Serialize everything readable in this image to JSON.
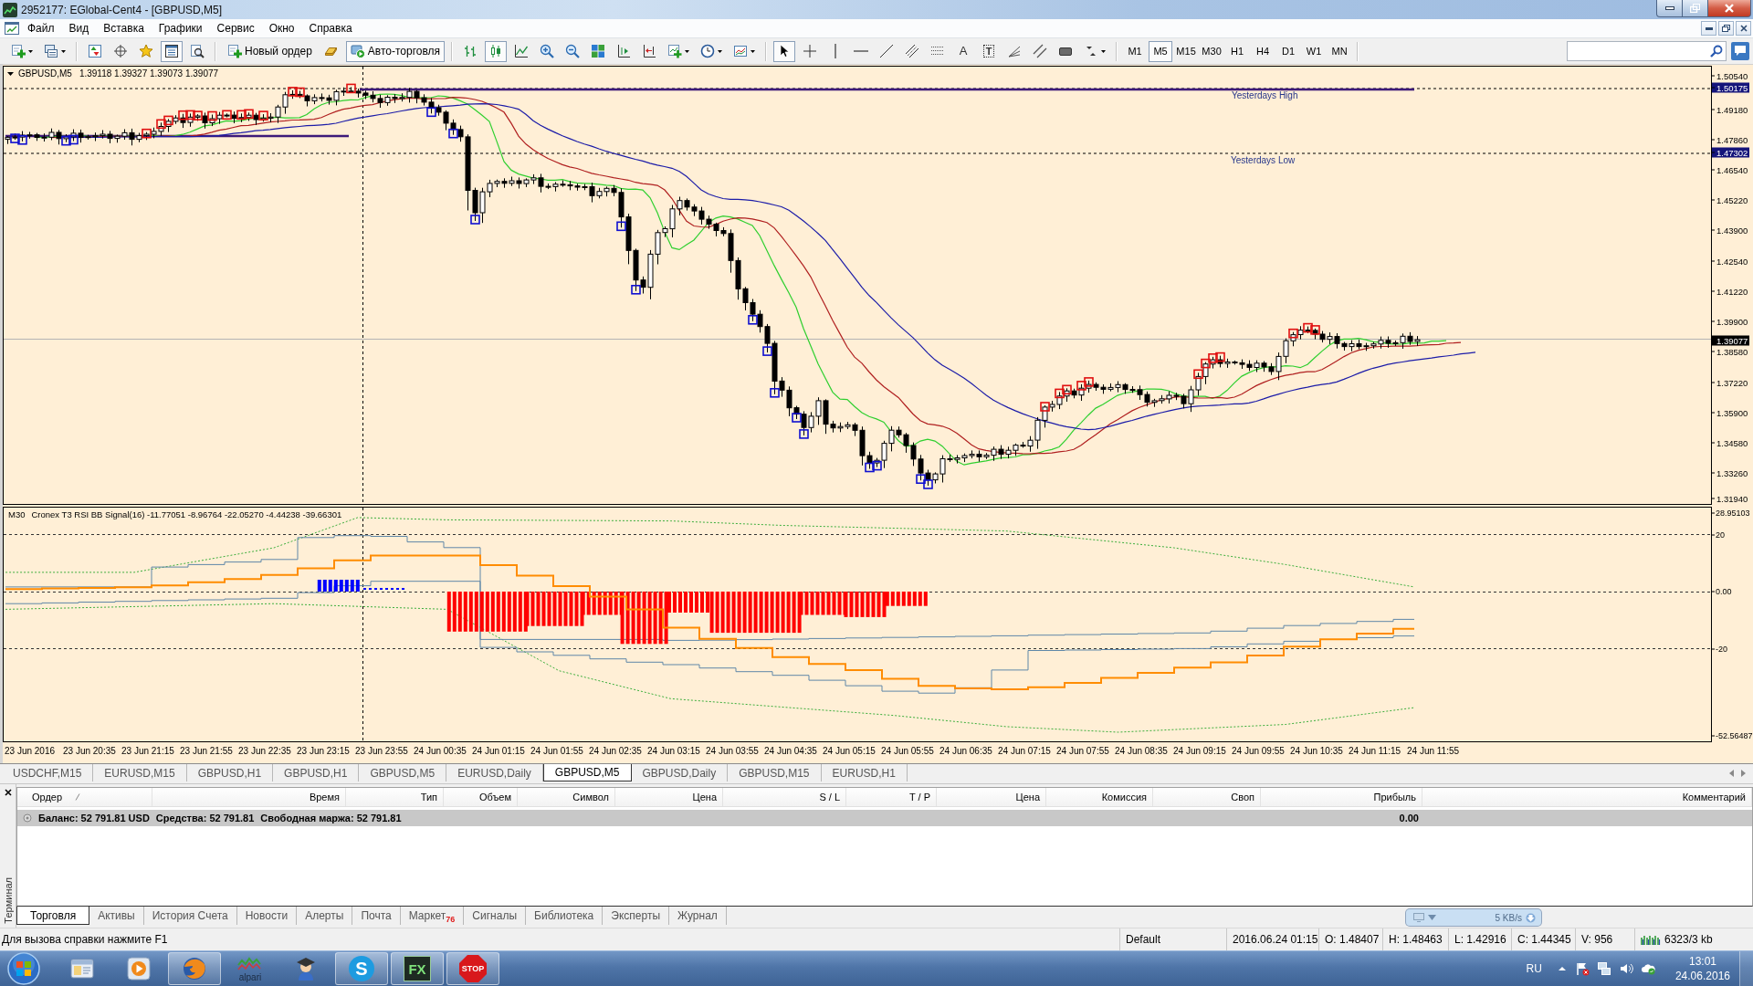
{
  "window": {
    "title": "2952177: EGlobal-Cent4 - [GBPUSD,M5]"
  },
  "menu": [
    "Файл",
    "Вид",
    "Вставка",
    "Графики",
    "Сервис",
    "Окно",
    "Справка"
  ],
  "toolbar": {
    "view_buttons": [
      {
        "pressed": false
      },
      {
        "pressed": false
      },
      {
        "pressed": false
      },
      {
        "pressed": true
      },
      {
        "pressed": false
      }
    ],
    "new_order": {
      "label": "Новый ордер"
    },
    "auto_trading": {
      "label": "Авто-торговля",
      "on": true
    },
    "chart_types": [
      {
        "selected": false
      },
      {
        "selected": true
      },
      {
        "selected": false
      }
    ],
    "cursor_modes": [
      {
        "selected": true
      },
      {
        "selected": false
      }
    ],
    "text_tools": [
      "A",
      "T"
    ],
    "timeframes": [
      {
        "label": "M1",
        "selected": false
      },
      {
        "label": "M5",
        "selected": true
      },
      {
        "label": "M15",
        "selected": false
      },
      {
        "label": "M30",
        "selected": false
      },
      {
        "label": "H1",
        "selected": false
      },
      {
        "label": "H4",
        "selected": false
      },
      {
        "label": "D1",
        "selected": false
      },
      {
        "label": "W1",
        "selected": false
      },
      {
        "label": "MN",
        "selected": false
      }
    ]
  },
  "chart": {
    "symbol": "GBPUSD,M5",
    "quote": "1.39118 1.39327 1.39073 1.39077",
    "level_labels": [
      "Yesterdays High",
      "Yesterdays Low"
    ],
    "price_axis": [
      {
        "label": "1.50540",
        "kind": "tick"
      },
      {
        "label": "1.50175",
        "kind": "level"
      },
      {
        "label": "1.49180",
        "kind": "tick"
      },
      {
        "label": "1.47860",
        "kind": "tick"
      },
      {
        "label": "1.47302",
        "kind": "level"
      },
      {
        "label": "1.46540",
        "kind": "tick"
      },
      {
        "label": "1.45220",
        "kind": "tick"
      },
      {
        "label": "1.43900",
        "kind": "tick"
      },
      {
        "label": "1.42540",
        "kind": "tick"
      },
      {
        "label": "1.41220",
        "kind": "tick"
      },
      {
        "label": "1.39900",
        "kind": "tick"
      },
      {
        "label": "1.39077",
        "kind": "bid"
      },
      {
        "label": "1.38580",
        "kind": "tick"
      },
      {
        "label": "1.37220",
        "kind": "tick"
      },
      {
        "label": "1.35900",
        "kind": "tick"
      },
      {
        "label": "1.34580",
        "kind": "tick"
      },
      {
        "label": "1.33260",
        "kind": "tick"
      },
      {
        "label": "1.31940",
        "kind": "tick"
      }
    ],
    "indicator": {
      "timeframe": "M30",
      "title": "Cronex T3 RSI BB Signal(16) -11.77051 -8.96764 -22.05270 -4.44238 -39.66301",
      "axis": [
        "28.95103",
        "20",
        "0.00",
        "-20",
        "-52.56487"
      ]
    },
    "time_axis": [
      "23 Jun 2016",
      "23 Jun 20:35",
      "23 Jun 21:15",
      "23 Jun 21:55",
      "23 Jun 22:35",
      "23 Jun 23:15",
      "23 Jun 23:55",
      "24 Jun 00:35",
      "24 Jun 01:15",
      "24 Jun 01:55",
      "24 Jun 02:35",
      "24 Jun 03:15",
      "24 Jun 03:55",
      "24 Jun 04:35",
      "24 Jun 05:15",
      "24 Jun 05:55",
      "24 Jun 06:35",
      "24 Jun 07:15",
      "24 Jun 07:55",
      "24 Jun 08:35",
      "24 Jun 09:15",
      "24 Jun 09:55",
      "24 Jun 10:35",
      "24 Jun 11:15",
      "24 Jun 11:55"
    ]
  },
  "chart_tabs": [
    {
      "label": "USDCHF,M15",
      "selected": false
    },
    {
      "label": "EURUSD,M15",
      "selected": false
    },
    {
      "label": "GBPUSD,H1",
      "selected": false
    },
    {
      "label": "GBPUSD,H1",
      "selected": false
    },
    {
      "label": "GBPUSD,M5",
      "selected": false
    },
    {
      "label": "EURUSD,Daily",
      "selected": false
    },
    {
      "label": "GBPUSD,M5",
      "selected": true
    },
    {
      "label": "GBPUSD,Daily",
      "selected": false
    },
    {
      "label": "GBPUSD,M15",
      "selected": false
    },
    {
      "label": "EURUSD,H1",
      "selected": false
    }
  ],
  "terminal": {
    "title": "Терминал",
    "columns": [
      "Ордер",
      "Время",
      "Тип",
      "Объем",
      "Символ",
      "Цена",
      "S / L",
      "T / P",
      "Цена",
      "Комиссия",
      "Своп",
      "Прибыль",
      "Комментарий"
    ],
    "summary": [
      "Баланс: 52 791.81 USD",
      "Средства: 52 791.81",
      "Свободная маржа: 52 791.81"
    ],
    "profit": "0.00",
    "tabs": [
      {
        "label": "Торговля",
        "selected": true
      },
      {
        "label": "Активы",
        "selected": false
      },
      {
        "label": "История Счета",
        "selected": false
      },
      {
        "label": "Новости",
        "selected": false
      },
      {
        "label": "Алерты",
        "selected": false
      },
      {
        "label": "Почта",
        "selected": false
      },
      {
        "label": "Маркет",
        "selected": false,
        "badge": "76"
      },
      {
        "label": "Сигналы",
        "selected": false
      },
      {
        "label": "Библиотека",
        "selected": false
      },
      {
        "label": "Эксперты",
        "selected": false
      },
      {
        "label": "Журнал",
        "selected": false
      }
    ]
  },
  "status_bar": {
    "help": "Для вызова справки нажмите F1",
    "profile": "Default",
    "fields": [
      "2016.06.24 01:15",
      "O: 1.48407",
      "H: 1.48463",
      "L: 1.42916",
      "C: 1.44345",
      "V: 956"
    ],
    "traffic": "6323/3 kb"
  },
  "network_monitor": {
    "speed": "5 KB/s"
  },
  "taskbar": {
    "apps": [
      {
        "active": false
      },
      {
        "active": false
      },
      {
        "active": true
      },
      {
        "active": false,
        "label": "alpari"
      },
      {
        "active": false
      },
      {
        "active": true,
        "label": "S"
      },
      {
        "active": true,
        "label": "FX"
      },
      {
        "active": true,
        "label": "STOP"
      }
    ],
    "language": "RU",
    "time": "13:01",
    "date": "24.06.2016"
  }
}
